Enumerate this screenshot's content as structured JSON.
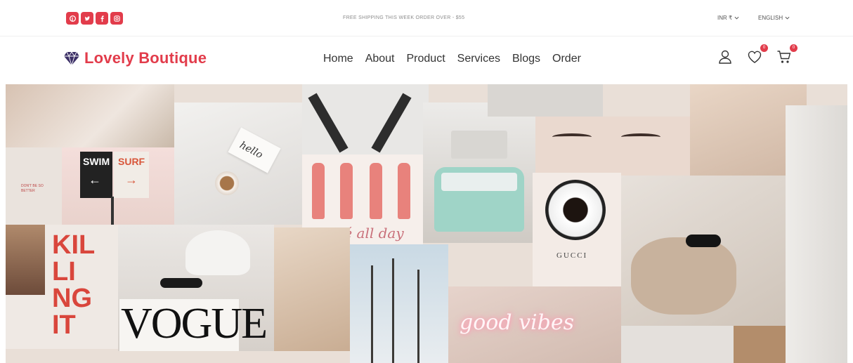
{
  "topbar": {
    "social": [
      {
        "name": "pinterest-icon"
      },
      {
        "name": "twitter-icon"
      },
      {
        "name": "facebook-icon"
      },
      {
        "name": "instagram-icon"
      }
    ],
    "promo": "FREE SHIPPING THIS WEEK ORDER OVER - $55",
    "currency": "INR ₹",
    "language": "ENGLISH"
  },
  "brand": {
    "name": "Lovely Boutique",
    "icon": "diamond-icon"
  },
  "nav": [
    "Home",
    "About",
    "Product",
    "Services",
    "Blogs",
    "Order"
  ],
  "header_icons": {
    "wishlist_count": "0",
    "cart_count": "0"
  },
  "hero": {
    "texts": {
      "swim": "SWIM",
      "surf": "SURF",
      "hello": "hello",
      "rose": "Rosé all day",
      "killing": [
        "KIL",
        "LI",
        "NG",
        "IT"
      ],
      "vogue": "VOGUE",
      "gucci": "GUCCI",
      "vibes": "good vibes",
      "small_sign": "DON'T BE SO BETTER"
    }
  },
  "colors": {
    "accent": "#e23c4b",
    "text": "#333333",
    "muted": "#8c8c8c"
  }
}
